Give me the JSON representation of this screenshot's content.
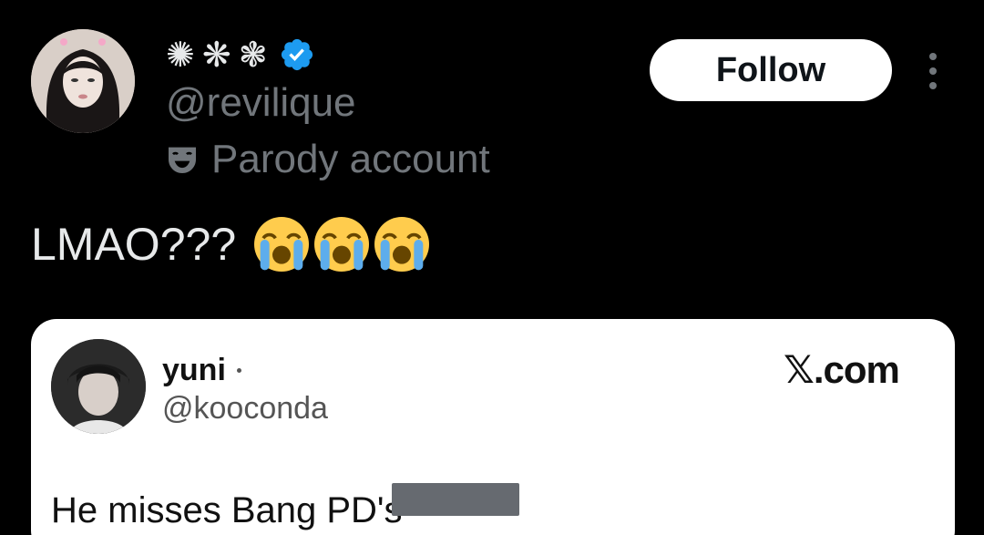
{
  "author": {
    "display_glyphs": [
      "✺",
      "❋",
      "❃"
    ],
    "verified_icon": "verified-badge-icon",
    "handle": "@revilique",
    "label_icon": "theater-mask-icon",
    "label": "Parody account",
    "follow_label": "Follow",
    "more_icon": "more-vertical-icon"
  },
  "tweet": {
    "text": "LMAO???",
    "emojis": [
      "loudly-crying-face",
      "loudly-crying-face",
      "loudly-crying-face"
    ]
  },
  "quoted": {
    "name": "yuni",
    "handle": "@kooconda",
    "source": "𝕏.com",
    "text": "He misses Bang PD's"
  },
  "colors": {
    "background": "#000000",
    "muted": "#71767b",
    "verified": "#1d9bf0",
    "emoji_yellow": "#ffcc4d",
    "tears": "#5dadec"
  }
}
